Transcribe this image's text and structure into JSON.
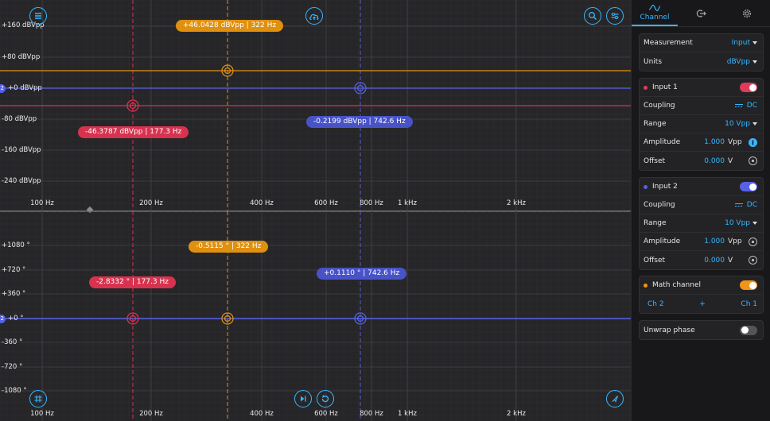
{
  "magnitude": {
    "y_labels": [
      "+160 dBVpp",
      "+80 dBVpp",
      "+0 dBVpp",
      "-80 dBVpp",
      "-160 dBVpp",
      "-240 dBVpp"
    ],
    "x_labels": [
      "100 Hz",
      "200 Hz",
      "400 Hz",
      "600 Hz",
      "800 Hz",
      "1 kHz",
      "2 kHz"
    ],
    "cursor_readouts": {
      "orange": "+46.0428 dBVpp | 322 Hz",
      "red": "-46.3787 dBVpp | 177.3 Hz",
      "blue": "-0.2199 dBVpp | 742.6 Hz"
    },
    "channel_marker": "2"
  },
  "phase": {
    "y_labels": [
      "+1080 °",
      "+720 °",
      "+360 °",
      "+0 °",
      "-360 °",
      "-720 °",
      "-1080 °"
    ],
    "x_labels": [
      "100 Hz",
      "200 Hz",
      "400 Hz",
      "600 Hz",
      "800 Hz",
      "1 kHz",
      "2 kHz"
    ],
    "cursor_readouts": {
      "orange": "-0.5115 ° | 322 Hz",
      "red": "-2.8332 ° | 177.3 Hz",
      "blue": "+0.1110 ° | 742.6 Hz"
    },
    "channel_marker": "2"
  },
  "toolbar_icons": [
    "menu-icon",
    "cloud-upload-icon",
    "zoom-icon",
    "sliders-icon",
    "grid-icon",
    "play-step-icon",
    "replay-icon",
    "cursor-icon"
  ],
  "sidebar": {
    "tabs": [
      {
        "label": "Channel"
      },
      {
        "label": ""
      },
      {
        "label": ""
      }
    ],
    "measurement": {
      "label": "Measurement",
      "value": "Input"
    },
    "units": {
      "label": "Units",
      "value": "dBVpp"
    },
    "input1": {
      "label": "Input 1",
      "coupling_label": "Coupling",
      "coupling": "DC",
      "range_label": "Range",
      "range": "10 Vpp",
      "amplitude_label": "Amplitude",
      "amplitude": "1.000",
      "amplitude_unit": "Vpp",
      "offset_label": "Offset",
      "offset": "0.000",
      "offset_unit": "V",
      "color": "#e03b5b"
    },
    "input2": {
      "label": "Input 2",
      "coupling_label": "Coupling",
      "coupling": "DC",
      "range_label": "Range",
      "range": "10 Vpp",
      "amplitude_label": "Amplitude",
      "amplitude": "1.000",
      "amplitude_unit": "Vpp",
      "offset_label": "Offset",
      "offset": "0.000",
      "offset_unit": "V",
      "color": "#5662e6"
    },
    "math": {
      "label": "Math channel",
      "left": "Ch 2",
      "op": "+",
      "right": "Ch 1",
      "color": "#f0941a"
    },
    "unwrap": {
      "label": "Unwrap phase"
    }
  },
  "colors": {
    "orange": "#e0900f",
    "red": "#d9324f",
    "blue": "#4853c8",
    "accent": "#38b6ff"
  }
}
